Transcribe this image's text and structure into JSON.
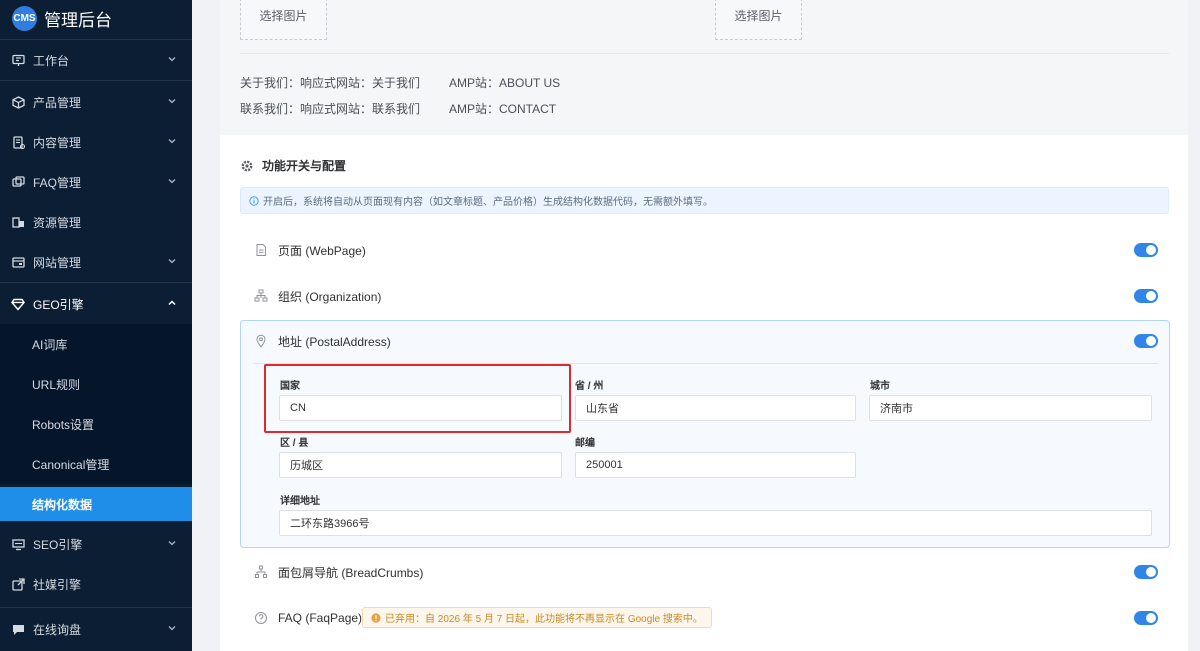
{
  "brand": {
    "logo_text": "CMS",
    "title": "管理后台"
  },
  "sidebar": {
    "items": [
      {
        "label": "工作台",
        "icon": "dashboard-icon",
        "has_arrow": true
      },
      {
        "label": "产品管理",
        "icon": "cube-icon",
        "has_arrow": true
      },
      {
        "label": "内容管理",
        "icon": "document-icon",
        "has_arrow": true
      },
      {
        "label": "FAQ管理",
        "icon": "faq-icon",
        "has_arrow": true
      },
      {
        "label": "资源管理",
        "icon": "resource-icon",
        "has_arrow": false
      },
      {
        "label": "网站管理",
        "icon": "website-icon",
        "has_arrow": true
      },
      {
        "label": "GEO引擎",
        "icon": "diamond-icon",
        "has_arrow": true,
        "expanded": true
      },
      {
        "label": "SEO引擎",
        "icon": "monitor-icon",
        "has_arrow": true
      },
      {
        "label": "社媒引擎",
        "icon": "share-icon",
        "has_arrow": false
      },
      {
        "label": "在线询盘",
        "icon": "chat-icon",
        "has_arrow": true
      }
    ],
    "geo_sub_items": [
      {
        "label": "AI词库",
        "active": false
      },
      {
        "label": "URL规则",
        "active": false
      },
      {
        "label": "Robots设置",
        "active": false
      },
      {
        "label": "Canonical管理",
        "active": false
      },
      {
        "label": "结构化数据",
        "active": true
      }
    ]
  },
  "top": {
    "select_image_left": "选择图片",
    "select_image_right": "选择图片",
    "about_label": "关于我们：响应式网站：关于我们",
    "about_amp": "AMP站：ABOUT US",
    "contact_label": "联系我们：响应式网站：联系我们",
    "contact_amp": "AMP站：CONTACT"
  },
  "section": {
    "title": "功能开关与配置",
    "info": "开启后，系统将自动从页面现有内容（如文章标题、产品价格）生成结构化数据代码，无需额外填写。"
  },
  "features": {
    "webpage": {
      "label": "页面 (WebPage)",
      "enabled": true
    },
    "organization": {
      "label": "组织 (Organization)",
      "enabled": true
    },
    "postal_address": {
      "label": "地址 (PostalAddress)",
      "enabled": true
    },
    "breadcrumbs": {
      "label": "面包屑导航 (BreadCrumbs)",
      "enabled": true
    },
    "faq": {
      "label": "FAQ (FaqPage)",
      "enabled": true,
      "badge": "已弃用：自 2026 年 5 月 7 日起，此功能将不再显示在 Google 搜索中。"
    }
  },
  "address": {
    "country_label": "国家",
    "country_value": "CN",
    "province_label": "省 / 州",
    "province_value": "山东省",
    "city_label": "城市",
    "city_value": "济南市",
    "district_label": "区 / 县",
    "district_value": "历城区",
    "postcode_label": "邮编",
    "postcode_value": "250001",
    "street_label": "详细地址",
    "street_value": "二环东路3966号"
  },
  "colors": {
    "sidebar_bg": "#0b1e33",
    "active": "#1f8ee9",
    "toggle_on": "#2f86e8",
    "highlight": "#e0292a"
  }
}
